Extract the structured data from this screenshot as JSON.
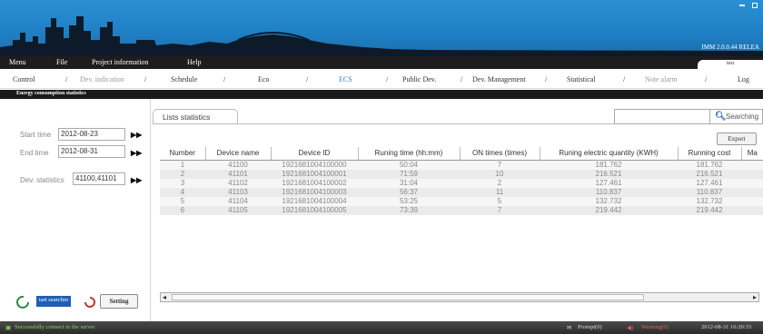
{
  "app": {
    "version": "IMM 2.0.0.44 RELEA",
    "user": "test"
  },
  "menu": [
    "Menu",
    "File",
    "Project information",
    "Help"
  ],
  "nav": {
    "control": "Control",
    "dev_indication": "Dev. indication",
    "schedule": "Schedule",
    "eco": "Eco",
    "ecs": "ECS",
    "public_dev": "Public Dev.",
    "dev_management": "Dev. Management",
    "statistical": "Statistical",
    "note_alarm": "Note alarm",
    "log": "Log",
    "sep": "/"
  },
  "section_title": "Energy consumption statistics",
  "filters": {
    "start_time_label": "Start time",
    "start_time_value": "2012-08-23",
    "end_time_label": "End time",
    "end_time_value": "2012-08-31",
    "dev_label": "Dev. statistics",
    "dev_value": "41100,41101"
  },
  "actions": {
    "search_label": "tart searchin",
    "setting_label": "Setting",
    "export_label": "Export"
  },
  "tab_label": "Lists statistics",
  "search_label": "Searching",
  "table": {
    "headers": [
      "Number",
      "Device name",
      "Device ID",
      "Runing time (hh:mm)",
      "ON times (times)",
      "Runing electric quantity (KWH)",
      "Running cost",
      "Ma"
    ],
    "rows": [
      [
        "1",
        "41100",
        "1921681004100000",
        "50:04",
        "7",
        "181.762",
        "181.762"
      ],
      [
        "2",
        "41101",
        "1921681004100001",
        "71:59",
        "10",
        "216.521",
        "216.521"
      ],
      [
        "3",
        "41102",
        "1921681004100002",
        "31:04",
        "2",
        "127.461",
        "127.461"
      ],
      [
        "4",
        "41103",
        "1921681004100003",
        "56:37",
        "11",
        "110.837",
        "110.837"
      ],
      [
        "5",
        "41104",
        "1921681004100004",
        "53:25",
        "5",
        "132.732",
        "132.732"
      ],
      [
        "6",
        "41105",
        "1921681004100005",
        "73:39",
        "7",
        "219.442",
        "219.442"
      ]
    ]
  },
  "status": {
    "connection": "Successfully connect to the server",
    "prompt": "Prompt(0)",
    "warning": "Warning(6)",
    "datetime": "2012-08-31 16:20:33"
  },
  "colors": {
    "banner": "#1f7fc4",
    "accent": "#2a7bd0",
    "menubar": "#1d1d1d",
    "ok": "#8ad45a",
    "warn": "#e06060"
  }
}
